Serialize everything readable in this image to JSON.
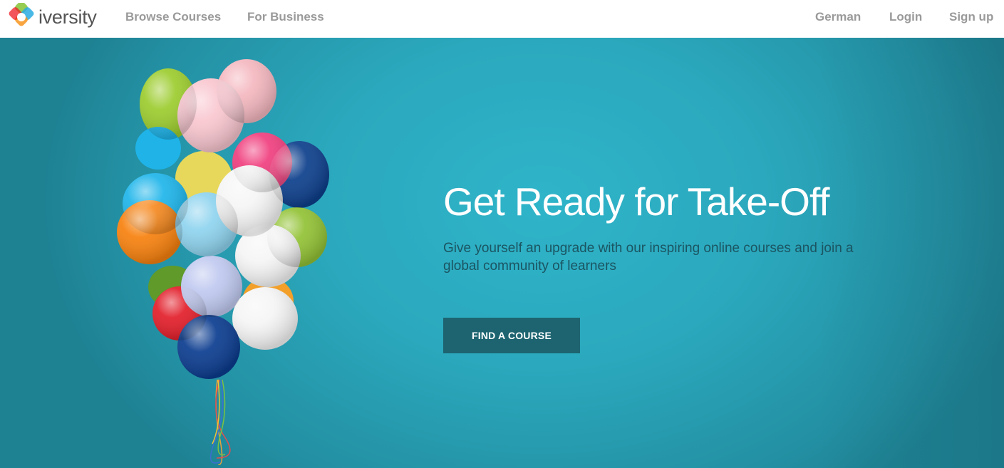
{
  "brand": {
    "name": "iversity"
  },
  "nav": {
    "left": [
      {
        "label": "Browse Courses"
      },
      {
        "label": "For Business"
      }
    ],
    "right": [
      {
        "label": "German"
      },
      {
        "label": "Login"
      },
      {
        "label": "Sign up"
      }
    ]
  },
  "hero": {
    "headline": "Get Ready for Take-Off",
    "subtext": "Give yourself an upgrade with our inspiring online courses and join a global community of learners",
    "cta_label": "FIND A COURSE",
    "image": "balloons-illustration"
  },
  "colors": {
    "hero_background": "#2ba8bd",
    "cta_background": "#1d6470",
    "nav_text": "#9a9a9a",
    "subtext": "#1b5562"
  }
}
